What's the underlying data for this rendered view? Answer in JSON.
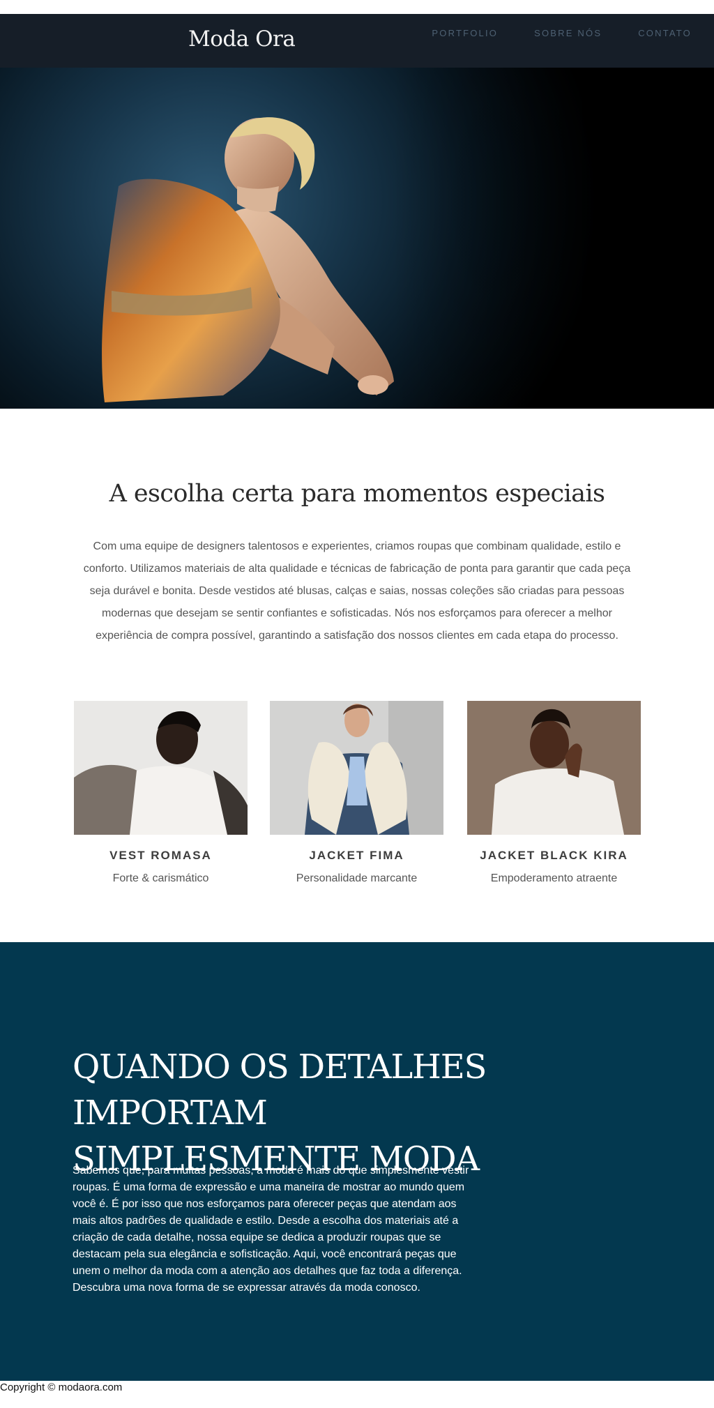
{
  "header": {
    "brand": "Moda Ora",
    "nav": [
      "PORTFOLIO",
      "SOBRE NÓS",
      "CONTATO"
    ]
  },
  "intro": {
    "title": "A escolha certa para momentos especiais",
    "text": "Com uma equipe de designers talentosos e experientes, criamos roupas que combinam qualidade, estilo e conforto. Utilizamos materiais de alta qualidade e técnicas de fabricação de ponta para garantir que cada peça seja durável e bonita. Desde vestidos até blusas, calças e saias, nossas coleções são criadas para pessoas modernas que desejam se sentir confiantes e sofisticadas. Nós nos esforçamos para oferecer a melhor experiência de compra possível, garantindo a satisfação dos nossos clientes em cada etapa do processo."
  },
  "products": [
    {
      "name": "VEST ROMASA",
      "desc": "Forte & carismático"
    },
    {
      "name": "JACKET FIMA",
      "desc": "Personalidade marcante"
    },
    {
      "name": "JACKET BLACK KIRA",
      "desc": "Empoderamento atraente"
    }
  ],
  "details": {
    "title_line1": "QUANDO OS DETALHES IMPORTAM",
    "title_line2": "SIMPLESMENTE MODA",
    "text": "Sabemos que, para muitas pessoas, a moda é mais do que simplesmente vestir roupas. É uma forma de expressão e uma maneira de mostrar ao mundo quem você é. É por isso que nos esforçamos para oferecer peças que atendam aos mais altos padrões de qualidade e estilo. Desde a escolha dos materiais até a criação de cada detalhe, nossa equipe se dedica a produzir roupas que se destacam pela sua elegância e sofisticação. Aqui, você encontrará peças que unem o melhor da moda com a atenção aos detalhes que faz toda a diferença. Descubra uma nova forma de se expressar através da moda conosco."
  },
  "footer": {
    "copyright": "Copyright © modaora.com"
  },
  "colors": {
    "header_bg": "#161e28",
    "nav_text": "#4e6173",
    "details_bg": "#03384f"
  }
}
